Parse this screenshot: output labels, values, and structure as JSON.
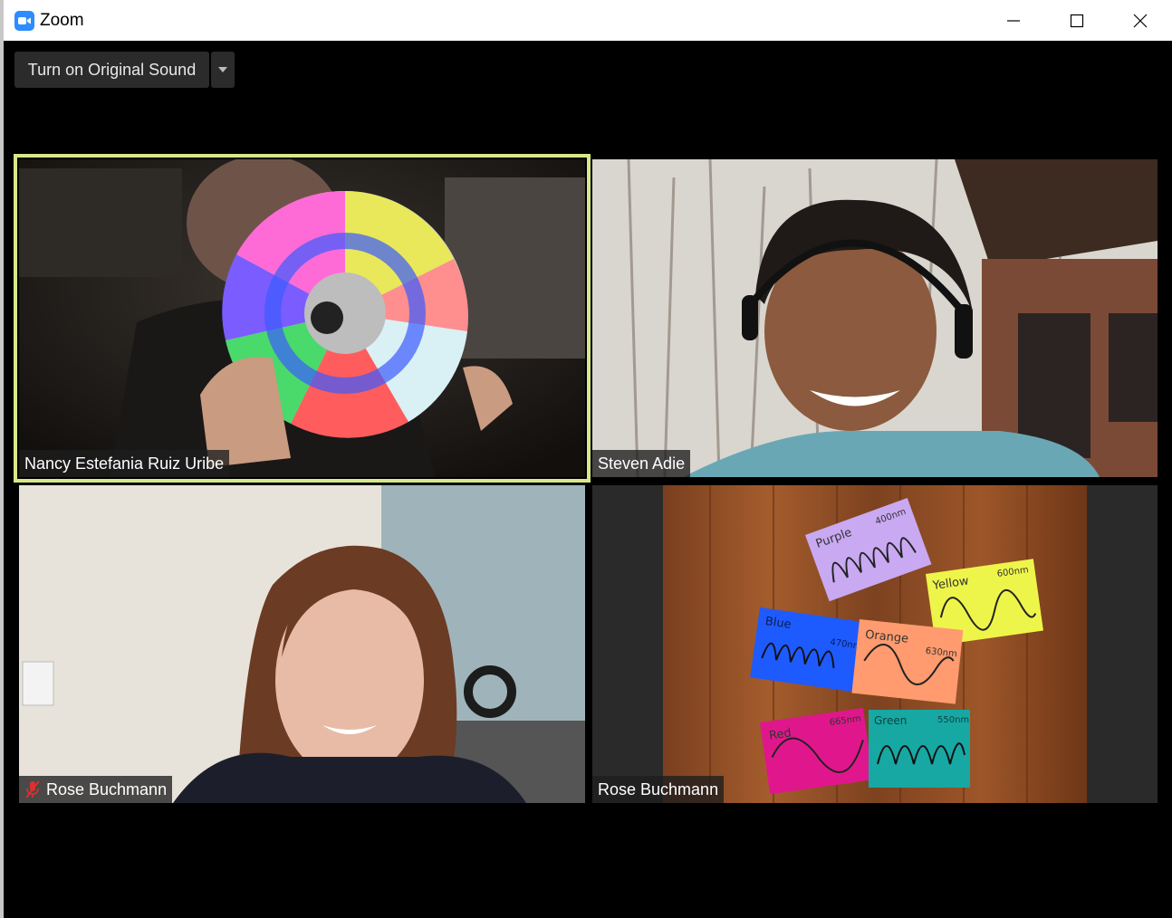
{
  "window": {
    "title": "Zoom",
    "controls": [
      "minimize-icon",
      "maximize-icon",
      "close-icon"
    ]
  },
  "toolbar": {
    "original_sound_label": "Turn on Original Sound",
    "dropdown_icon": "caret-down-icon"
  },
  "colors": {
    "active_speaker_border": "#d6e88a",
    "zoom_blue": "#2d8cff",
    "mute_red": "#e02f2f"
  },
  "participants": [
    {
      "name": "Nancy Estefania Ruiz Uribe",
      "active_speaker": true,
      "muted": false
    },
    {
      "name": "Steven Adie",
      "active_speaker": false,
      "muted": false
    },
    {
      "name": "Rose Buchmann",
      "active_speaker": false,
      "muted": true
    },
    {
      "name": "Rose Buchmann",
      "active_speaker": false,
      "muted": false
    }
  ],
  "poster_cards": [
    {
      "color_name": "Purple",
      "wavelength": "400nm"
    },
    {
      "color_name": "Yellow",
      "wavelength": "600nm"
    },
    {
      "color_name": "Blue",
      "wavelength": "470nm"
    },
    {
      "color_name": "Orange",
      "wavelength": "630nm"
    },
    {
      "color_name": "Red",
      "wavelength": "665nm"
    },
    {
      "color_name": "Green",
      "wavelength": "550nm"
    }
  ]
}
